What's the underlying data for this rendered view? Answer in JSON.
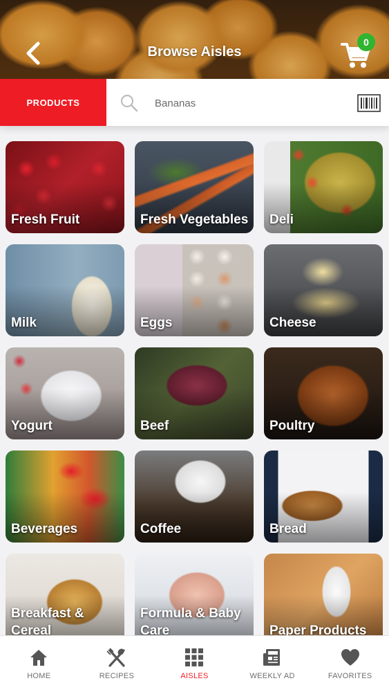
{
  "header": {
    "title": "Browse Aisles",
    "back_icon": "chevron-left-icon",
    "cart_icon": "shopping-cart-icon",
    "cart_count": "0",
    "badge_color": "#2fb52f"
  },
  "search": {
    "mode_label": "PRODUCTS",
    "placeholder": "Bananas",
    "search_icon": "magnifier-icon",
    "barcode_icon": "barcode-icon",
    "accent": "#ee1c25"
  },
  "aisles": [
    {
      "label": "Fresh Fruit"
    },
    {
      "label": "Fresh Vegetables"
    },
    {
      "label": "Deli"
    },
    {
      "label": "Milk"
    },
    {
      "label": "Eggs"
    },
    {
      "label": "Cheese"
    },
    {
      "label": "Yogurt"
    },
    {
      "label": "Beef"
    },
    {
      "label": "Poultry"
    },
    {
      "label": "Beverages"
    },
    {
      "label": "Coffee"
    },
    {
      "label": "Bread"
    },
    {
      "label": "Breakfast & Cereal"
    },
    {
      "label": "Formula & Baby Care"
    },
    {
      "label": "Paper Products"
    }
  ],
  "nav": {
    "items": [
      {
        "label": "HOME",
        "icon": "home-icon"
      },
      {
        "label": "RECIPES",
        "icon": "fork-spoon-icon"
      },
      {
        "label": "AISLES",
        "icon": "grid-icon",
        "active": true
      },
      {
        "label": "WEEKLY AD",
        "icon": "newspaper-icon"
      },
      {
        "label": "FAVORITES",
        "icon": "heart-icon"
      }
    ]
  }
}
